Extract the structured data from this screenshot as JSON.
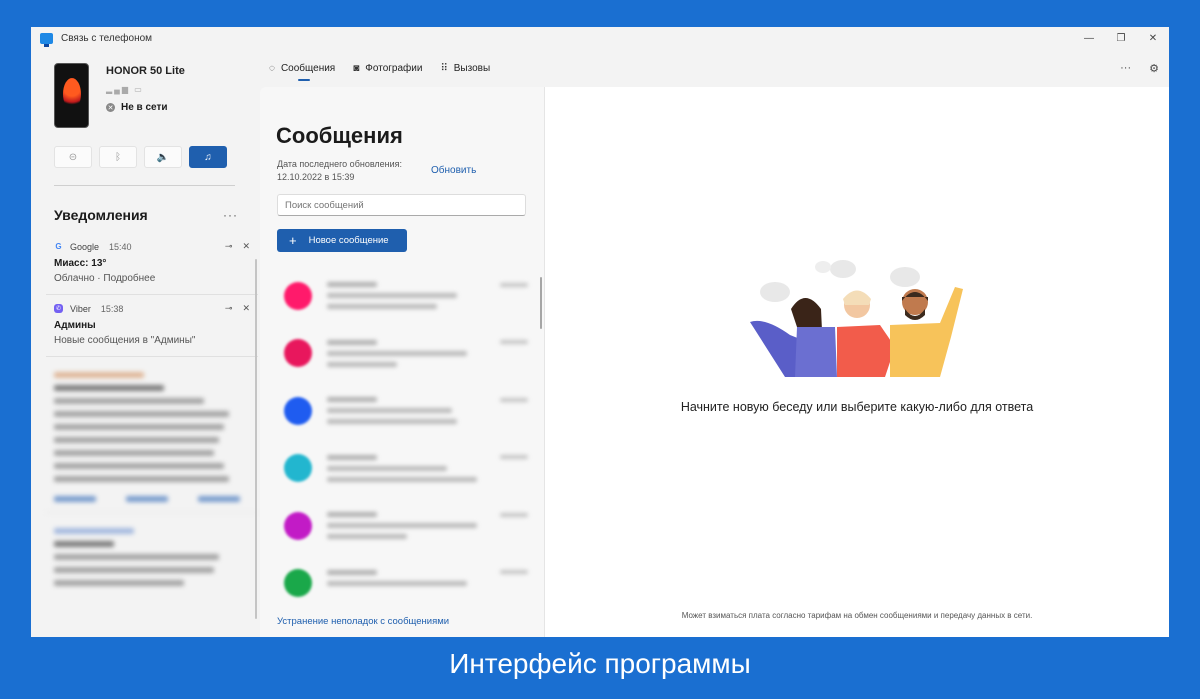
{
  "window": {
    "title": "Связь с телефоном",
    "controls": [
      "—",
      "❐",
      "✕"
    ]
  },
  "phone": {
    "name": "HONOR 50 Lite",
    "status": "Не в сети"
  },
  "quick_actions": [
    {
      "icon": "do-not-disturb-icon",
      "glyph": "⊝"
    },
    {
      "icon": "bluetooth-icon",
      "glyph": "ᛒ"
    },
    {
      "icon": "volume-icon",
      "glyph": "🔈"
    },
    {
      "icon": "music-icon",
      "glyph": "♫",
      "active": true
    }
  ],
  "notifications": {
    "title": "Уведомления",
    "items": [
      {
        "app": "Google",
        "time": "15:40",
        "heading": "Миасс: 13°",
        "body": "Облачно · Подробнее"
      },
      {
        "app": "Viber",
        "time": "15:38",
        "heading": "Админы",
        "body": "Новые сообщения в \"Админы\""
      }
    ]
  },
  "tabs": [
    {
      "label": "Сообщения",
      "icon": "chat-icon",
      "glyph": "💬"
    },
    {
      "label": "Фотографии",
      "icon": "photo-icon",
      "glyph": "▣"
    },
    {
      "label": "Вызовы",
      "icon": "dialpad-icon",
      "glyph": "⠿"
    }
  ],
  "messages": {
    "title": "Сообщения",
    "update_label": "Дата последнего обновления:",
    "update_date": "12.10.2022 в 15:39",
    "refresh": "Обновить",
    "search_placeholder": "Поиск сообщений",
    "new_message": "Новое сообщение",
    "troubleshoot": "Устранение неполадок с сообщениями",
    "avatar_colors": [
      "#ff1a6b",
      "#e8175d",
      "#1f5cf0",
      "#22b6cf",
      "#c21bc6",
      "#1aa84a"
    ]
  },
  "main": {
    "empty_text": "Начните новую беседу или выберите какую-либо для ответа",
    "footnote": "Может взиматься плата согласно тарифам на обмен сообщениями и передачу данных в сети."
  },
  "caption": "Интерфейс программы"
}
